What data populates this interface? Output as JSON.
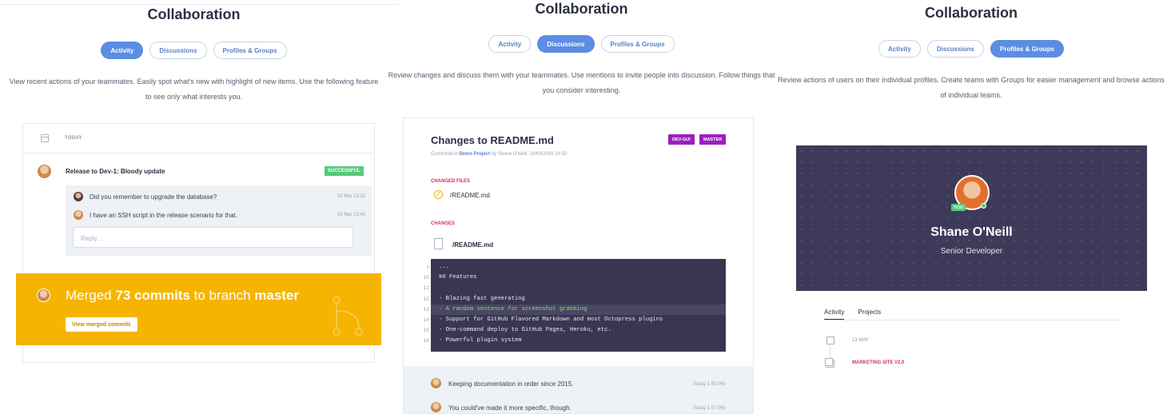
{
  "panels": [
    {
      "title": "Collaboration",
      "tabs": [
        "Activity",
        "Discussions",
        "Profiles & Groups"
      ],
      "active_tab": "Activity",
      "description": "View recent actions of your teammates. Easily spot what's new with highlight of new items. Use the following feature to see only what interests you."
    },
    {
      "title": "Collaboration",
      "tabs": [
        "Activity",
        "Discussions",
        "Profiles & Groups"
      ],
      "active_tab": "Discussions",
      "description": "Review changes and discuss them with your teammates. Use mentions to invite people into discussion. Follow things that you consider interesting."
    },
    {
      "title": "Collaboration",
      "tabs": [
        "Activity",
        "Discussions",
        "Profiles & Groups"
      ],
      "active_tab": "Profiles & Groups",
      "description": "Review actions of users on their individual profiles. Create teams with Groups for easier management and browse actions of individual teams."
    }
  ],
  "activity": {
    "day_label": "TODAY",
    "event_title": "Release to Dev-1: Bloody update",
    "status_badge": "SUCCESSFUL",
    "comments": [
      {
        "text": "Did you remember to upgrade the database?",
        "time": "19 Mar 13:33"
      },
      {
        "text": "I have an SSH script in the release scenario for that.",
        "time": "19 Mar 13:45"
      }
    ],
    "reply_placeholder": "Reply...",
    "banner": {
      "prefix": "Merged ",
      "count": "73 commits",
      "middle": " to branch ",
      "branch": "master",
      "button": "View merged commits"
    }
  },
  "discussion": {
    "title": "Changes to README.md",
    "sub_prefix": "Commited in ",
    "project": "Demo Project",
    "sub_suffix": " by Shane O'Neill, 19/03/2015 14:52",
    "tags": [
      "DEV-GUI",
      "MASTER"
    ],
    "changed_files_label": "CHANGED FILES",
    "changed_file": "/README.md",
    "changes_label": "CHANGES",
    "change_file": "/README.md",
    "code": {
      "line_numbers": [
        "",
        "10",
        "11",
        "12",
        "13",
        "14",
        "15",
        "16"
      ],
      "lines": [
        "...",
        "## Features",
        "",
        "- Blazing fast generating",
        "- A random sentence for screenshot grabbing",
        "- Support for GitHub Flavored Markdown and most Octopress plugins",
        "- One-command deploy to GitHub Pages, Heroku, etc.",
        "- Powerful plugin system"
      ],
      "highlight_index": 4
    },
    "comments": [
      {
        "text": "Keeping documentation in order since 2015.",
        "time": "Today 1:50 PM"
      },
      {
        "text": "You could've made it more specific, though.",
        "time": "Today 1:57 PM"
      }
    ]
  },
  "profile": {
    "you_badge": "YOU",
    "name": "Shane O'Neill",
    "role": "Senior Developer",
    "tabs": [
      "Activity",
      "Projects"
    ],
    "date": "13 MAY",
    "item": "MARKETING SITE V2.0"
  },
  "colors": {
    "accent": "#5b8de2",
    "banner": "#f5b400",
    "success": "#54c97a",
    "tag": "#9b1fbf",
    "profile_bg": "#3d3a5a",
    "magenta": "#d22a7b"
  }
}
